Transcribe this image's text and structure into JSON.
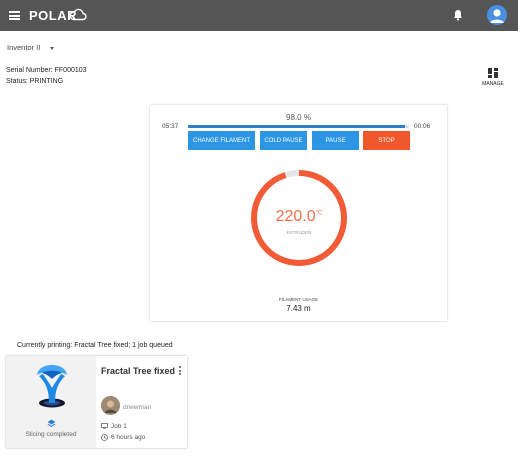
{
  "header": {
    "logo_text": "POLAR",
    "icons": [
      "menu-icon",
      "cloud-icon",
      "bell-icon",
      "avatar-icon"
    ]
  },
  "printer": {
    "name": "Inventor II",
    "serial": "Serial Number: FF000103",
    "status": "Status: PRINTING"
  },
  "manage": {
    "label": "MANAGE",
    "icon": "dashboard-icon"
  },
  "print_panel": {
    "progress_percent_label": "98.0 %",
    "progress_fraction": 0.98,
    "time_elapsed": "05:37",
    "time_remaining": "00:06",
    "buttons": {
      "change_filament": "CHANGE FILAMENT",
      "cold_pause": "COLD PAUSE",
      "pause": "PAUSE",
      "stop": "STOP"
    },
    "temperature": {
      "value": "220.0",
      "unit": "°C",
      "label": "EXTRUDER",
      "fraction": 0.95
    },
    "filament": {
      "label": "FILAMENT USAGE",
      "value": "7.43 m"
    }
  },
  "queue": {
    "summary": "Currently printing: Fractal Tree fixed; 1 job queued"
  },
  "job_card": {
    "title": "Fractal Tree fixed",
    "slicing_status": "Slicing completed",
    "username": "dnewman",
    "job_number": "Job 1",
    "time_ago": "6 hours ago"
  },
  "colors": {
    "topbar": "#555555",
    "accent_blue": "#2d96e4",
    "stop_orange": "#f0582c",
    "gauge_red": "#f35a36",
    "temp_text": "#f36e4b"
  }
}
